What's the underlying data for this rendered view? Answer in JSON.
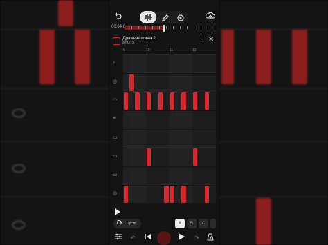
{
  "app": {
    "time": "00:04.0",
    "pattern_title": "Драм-машина 2",
    "pattern_subtitle": "BPM: 3",
    "bar_numbers": [
      "9",
      "10",
      "11",
      "12"
    ],
    "fx_label": "Fx",
    "fx_preset": "Пусто",
    "pattern_buttons": [
      "A",
      "B",
      "C"
    ],
    "selected_pattern": "A"
  },
  "colors": {
    "note": "#d8282e",
    "accent": "#c22",
    "background": "#141414"
  },
  "icons": {
    "undo_top": "undo-icon",
    "waveform": "waveform-icon",
    "pencil": "pencil-icon",
    "settings": "gear-icon",
    "cloud": "cloud-upload-icon",
    "more": "more-vertical-icon",
    "close": "close-icon",
    "play": "play-icon",
    "mixer": "mixer-icon",
    "undo": "undo-icon",
    "redo": "redo-icon",
    "skip_back": "skip-back-icon",
    "record": "record-icon",
    "play_main": "play-icon",
    "metronome": "metronome-icon"
  },
  "lanes": [
    {
      "icon": "♪",
      "steps": []
    },
    {
      "icon": "◎",
      "steps": [
        1
      ]
    },
    {
      "icon": "◠",
      "steps": [
        0,
        2,
        4,
        6,
        8,
        10,
        12,
        14
      ]
    },
    {
      "icon": "≡",
      "steps": []
    },
    {
      "icon": "▭",
      "steps": []
    },
    {
      "icon": "▭",
      "steps": [
        4,
        12
      ]
    },
    {
      "icon": "▭",
      "steps": []
    },
    {
      "icon": "◎",
      "steps": [
        0,
        7,
        8,
        10,
        14
      ]
    }
  ]
}
